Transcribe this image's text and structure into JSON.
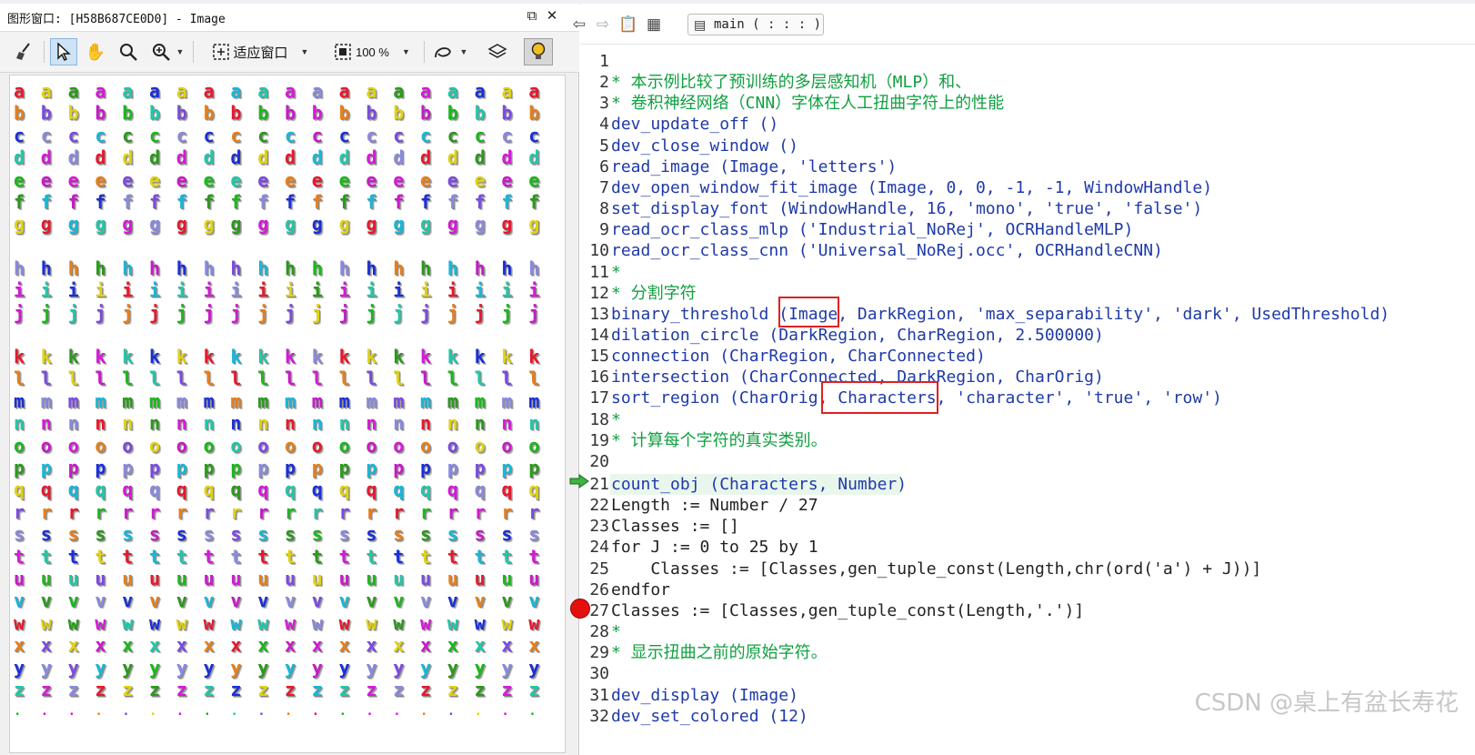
{
  "image_window": {
    "title": "图形窗口: [H58B687CE0D0] - Image",
    "toolbar": {
      "fit_label": "适应窗口",
      "zoom_label": "100 %"
    },
    "grid": {
      "letters": [
        "a",
        "b",
        "c",
        "d",
        "e",
        "f",
        "g",
        "",
        "h",
        "i",
        "j",
        "",
        "k",
        "l",
        "m",
        "n",
        "o",
        "p",
        "q",
        "r",
        "s",
        "t",
        "u",
        "v",
        "w",
        "x",
        "y",
        "z",
        "."
      ],
      "palette": [
        "#e8182c",
        "#7b4be0",
        "#1a2fd8",
        "#d41ad6",
        "#1ab81a",
        "#17b8d8",
        "#e0d218",
        "#e87f1a",
        "#8a8ae0",
        "#21c8a8",
        "#c81ac8",
        "#2a9a1a"
      ]
    }
  },
  "editor": {
    "proc_label": "main ( : : : )",
    "lines": [
      {
        "no": "1",
        "text": "",
        "style": "plain"
      },
      {
        "no": "2",
        "text": "* 本示例比较了预训练的多层感知机（MLP）和、",
        "style": "comment"
      },
      {
        "no": "3",
        "text": "* 卷积神经网络（CNN）字体在人工扭曲字符上的性能",
        "style": "comment"
      },
      {
        "no": "4",
        "text": "dev_update_off ()",
        "style": "op"
      },
      {
        "no": "5",
        "text": "dev_close_window ()",
        "style": "op"
      },
      {
        "no": "6",
        "text": "read_image (Image, 'letters')",
        "style": "op"
      },
      {
        "no": "7",
        "text": "dev_open_window_fit_image (Image, 0, 0, -1, -1, WindowHandle)",
        "style": "op"
      },
      {
        "no": "8",
        "text": "set_display_font (WindowHandle, 16, 'mono', 'true', 'false')",
        "style": "op"
      },
      {
        "no": "9",
        "text": "read_ocr_class_mlp ('Industrial_NoRej', OCRHandleMLP)",
        "style": "op"
      },
      {
        "no": "10",
        "text": "read_ocr_class_cnn ('Universal_NoRej.occ', OCRHandleCNN)",
        "style": "op"
      },
      {
        "no": "11",
        "text": "*",
        "style": "comment"
      },
      {
        "no": "12",
        "text": "* 分割字符",
        "style": "comment"
      },
      {
        "no": "13",
        "text": "binary_threshold (Image, DarkRegion, 'max_separability', 'dark', UsedThreshold)",
        "style": "op"
      },
      {
        "no": "14",
        "text": "dilation_circle (DarkRegion, CharRegion, 2.500000)",
        "style": "op"
      },
      {
        "no": "15",
        "text": "connection (CharRegion, CharConnected)",
        "style": "op"
      },
      {
        "no": "16",
        "text": "intersection (CharConnected, DarkRegion, CharOrig)",
        "style": "op"
      },
      {
        "no": "17",
        "text": "sort_region (CharOrig, Characters, 'character', 'true', 'row')",
        "style": "op"
      },
      {
        "no": "18",
        "text": "*",
        "style": "comment"
      },
      {
        "no": "19",
        "text": "* 计算每个字符的真实类别。",
        "style": "comment"
      },
      {
        "no": "20",
        "text": "",
        "style": "plain"
      },
      {
        "no": "21",
        "text": "count_obj (Characters, Number)",
        "style": "op"
      },
      {
        "no": "22",
        "text": "Length := Number / 27",
        "style": "plain"
      },
      {
        "no": "23",
        "text": "Classes := []",
        "style": "plain"
      },
      {
        "no": "24",
        "text": "for J := 0 to 25 by 1",
        "style": "plain"
      },
      {
        "no": "25",
        "text": "    Classes := [Classes,gen_tuple_const(Length,chr(ord('a') + J))]",
        "style": "plain"
      },
      {
        "no": "26",
        "text": "endfor",
        "style": "plain"
      },
      {
        "no": "27",
        "text": "Classes := [Classes,gen_tuple_const(Length,'.')]",
        "style": "plain"
      },
      {
        "no": "28",
        "text": "*",
        "style": "comment"
      },
      {
        "no": "29",
        "text": "* 显示扭曲之前的原始字符。",
        "style": "comment"
      },
      {
        "no": "30",
        "text": "",
        "style": "plain"
      },
      {
        "no": "31",
        "text": "dev_display (Image)",
        "style": "op"
      },
      {
        "no": "32",
        "text": "dev_set_colored (12)",
        "style": "op"
      }
    ]
  },
  "watermark": "CSDN @桌上有盆长寿花"
}
